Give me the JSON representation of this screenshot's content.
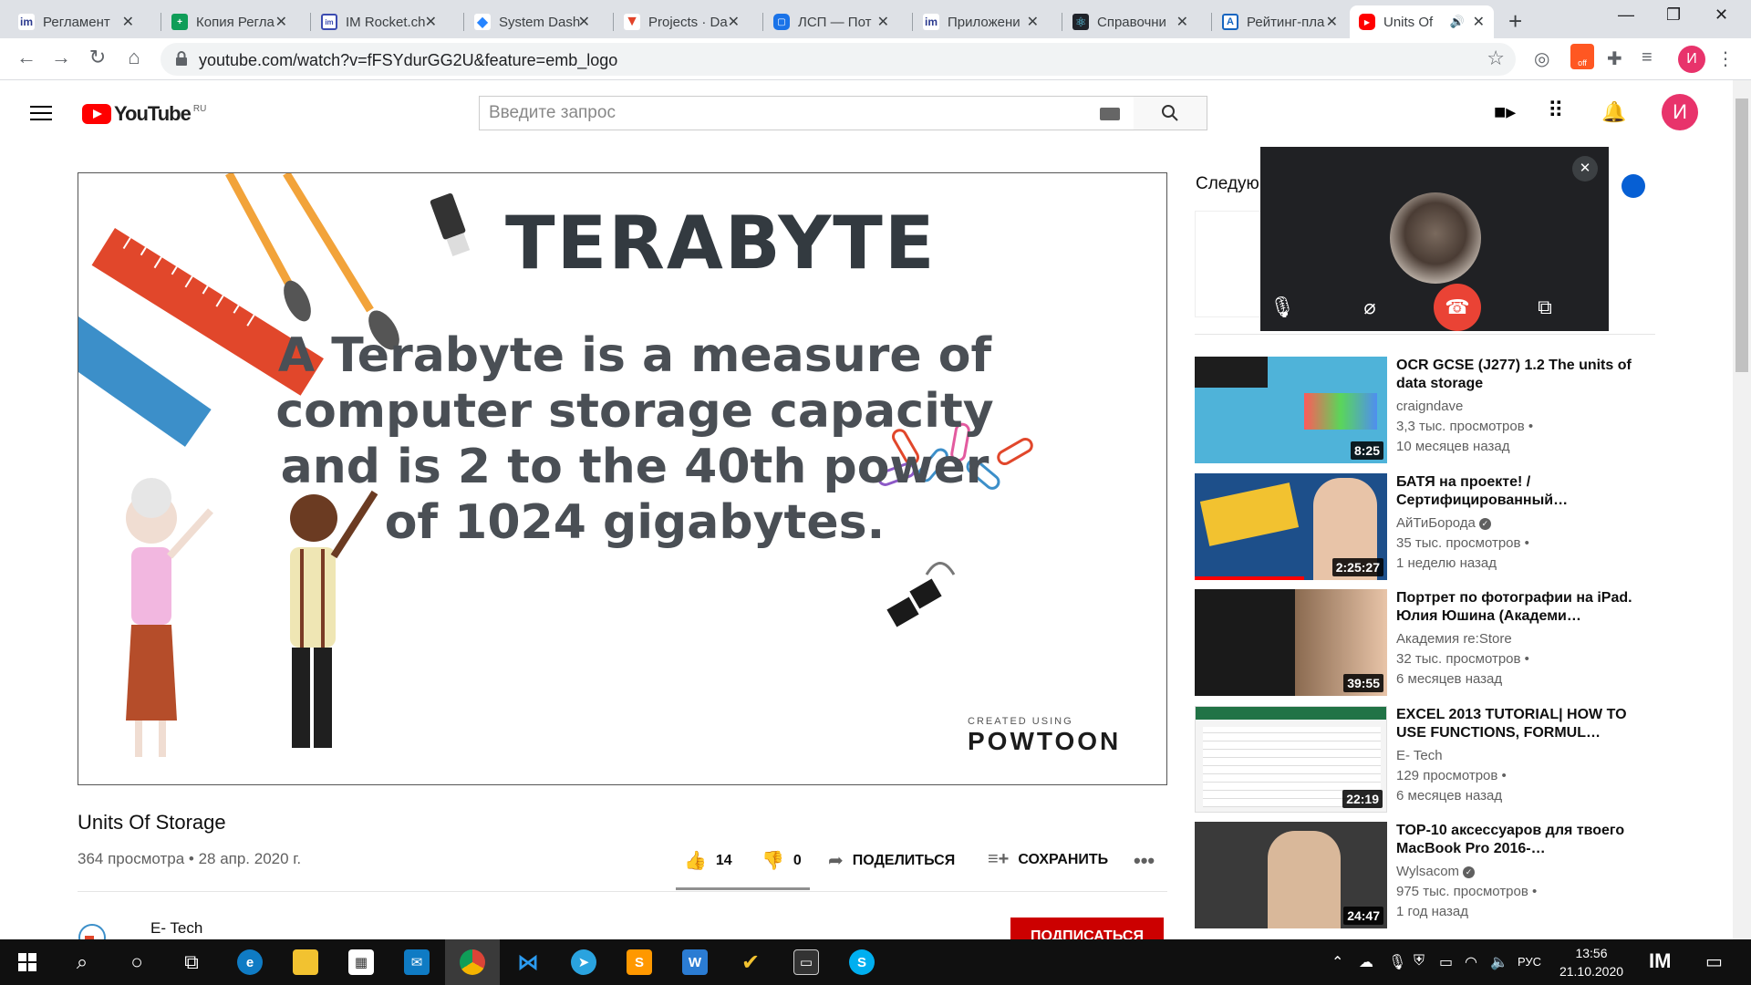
{
  "browser": {
    "tabs": [
      {
        "label": "Регламент",
        "icon": "im-icon",
        "color": "#2b3a8f"
      },
      {
        "label": "Копия Регла",
        "icon": "google-sheets-icon",
        "color": "#0f9d58"
      },
      {
        "label": "IM Rocket.ch",
        "icon": "rocket-chat-icon",
        "color": "#3b4bb0"
      },
      {
        "label": "System Dash",
        "icon": "jira-icon",
        "color": "#2684ff"
      },
      {
        "label": "Projects · Da",
        "icon": "gitlab-icon",
        "color": "#e24329"
      },
      {
        "label": "ЛСП — Пот",
        "icon": "chat-icon",
        "color": "#1a73e8"
      },
      {
        "label": "Приложени",
        "icon": "im-icon",
        "color": "#2b3a8f"
      },
      {
        "label": "Справочни",
        "icon": "react-icon",
        "color": "#20232a"
      },
      {
        "label": "Рейтинг-пла",
        "icon": "rating-icon",
        "color": "#1565c0"
      },
      {
        "label": "Units Of",
        "icon": "youtube-icon",
        "color": "#ff0000"
      }
    ],
    "url": "youtube.com/watch?v=fFSYdurGG2U&feature=emb_logo",
    "profile_initial": "И",
    "ext_badge": "off"
  },
  "youtube": {
    "logo_text": "YouTube",
    "logo_region": "RU",
    "search_placeholder": "Введите запрос",
    "avatar_initial": "И"
  },
  "video": {
    "slide_title": "TERABYTE",
    "slide_body": "A Terabyte is a measure of computer storage capacity and is 2 to the 40th power of 1024 gigabytes.",
    "powtoon_small": "CREATED USING",
    "powtoon_big": "POWTOON",
    "title": "Units Of Storage",
    "meta": "364 просмотра • 28 апр. 2020 г.",
    "likes": "14",
    "dislikes": "0",
    "share": "ПОДЕЛИТЬСЯ",
    "save": "СОХРАНИТЬ",
    "channel": "E- Tech",
    "subscribe": "ПОДПИСАТЬСЯ"
  },
  "sidebar": {
    "next_label": "Следую",
    "recommendations": [
      {
        "title": "OCR GCSE (J277) 1.2 The units of data storage",
        "channel": "craigndave",
        "verified": false,
        "views": "3,3 тыс. просмотров •",
        "age": "10 месяцев назад",
        "duration": "8:25",
        "thumb_color": "#4fb3d9"
      },
      {
        "title": "БАТЯ на проекте! / Сертифицированный…",
        "channel": "АйТиБорода",
        "verified": true,
        "views": "35 тыс. просмотров •",
        "age": "1 неделю назад",
        "duration": "2:25:27",
        "thumb_color": "#1d4f8a"
      },
      {
        "title": "Портрет по фотографии на iPad. Юлия Юшина (Академи…",
        "channel": "Академия re:Store",
        "verified": false,
        "views": "32 тыс. просмотров •",
        "age": "6 месяцев назад",
        "duration": "39:55",
        "thumb_color": "#1a1a1a"
      },
      {
        "title": "EXCEL 2013 TUTORIAL| HOW TO USE FUNCTIONS, FORMUL…",
        "channel": "E- Tech",
        "verified": false,
        "views": "129 просмотров •",
        "age": "6 месяцев назад",
        "duration": "22:19",
        "thumb_color": "#f4f4f4"
      },
      {
        "title": "TOP-10 аксессуаров для твоего MacBook Pro 2016-…",
        "channel": "Wylsacom",
        "verified": true,
        "views": "975 тыс. просмотров •",
        "age": "1 год назад",
        "duration": "24:47",
        "thumb_color": "#3a3a3a"
      }
    ]
  },
  "taskbar": {
    "lang": "РУС",
    "time": "13:56",
    "date": "21.10.2020"
  }
}
